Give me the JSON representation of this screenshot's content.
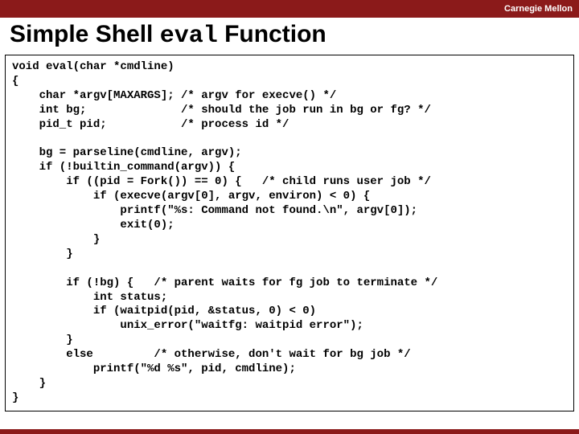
{
  "header": {
    "institution": "Carnegie Mellon",
    "title_prefix": "Simple Shell ",
    "title_code": "eval",
    "title_suffix": " Function"
  },
  "code": "void eval(char *cmdline)\n{\n    char *argv[MAXARGS]; /* argv for execve() */\n    int bg;              /* should the job run in bg or fg? */\n    pid_t pid;           /* process id */\n\n    bg = parseline(cmdline, argv);\n    if (!builtin_command(argv)) {\n        if ((pid = Fork()) == 0) {   /* child runs user job */\n            if (execve(argv[0], argv, environ) < 0) {\n                printf(\"%s: Command not found.\\n\", argv[0]);\n                exit(0);\n            }\n        }\n\n        if (!bg) {   /* parent waits for fg job to terminate */\n            int status;\n            if (waitpid(pid, &status, 0) < 0)\n                unix_error(\"waitfg: waitpid error\");\n        }\n        else         /* otherwise, don't wait for bg job */\n            printf(\"%d %s\", pid, cmdline);\n    }\n}"
}
